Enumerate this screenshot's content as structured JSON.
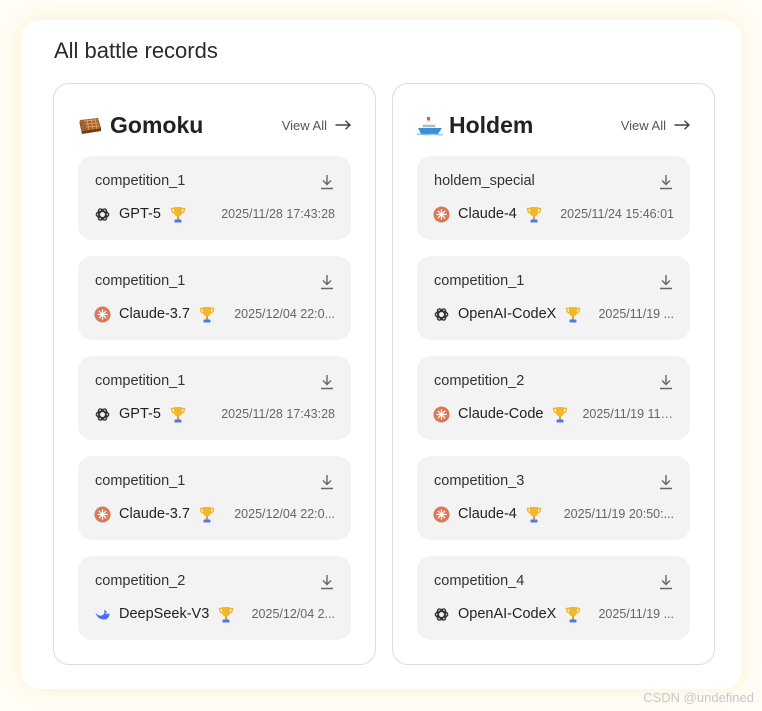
{
  "page_title": "All battle records",
  "watermark": "CSDN @undefined",
  "colors": {
    "claude": "#d97757",
    "deepseek": "#4d6bfe",
    "trophy": "#f2b72a"
  },
  "games": [
    {
      "name": "Gomoku",
      "icon": "gomoku-board-icon",
      "view_all": "View All",
      "records": [
        {
          "name": "competition_1",
          "model": "GPT-5",
          "model_icon": "openai-icon",
          "time": "2025/11/28 17:43:28"
        },
        {
          "name": "competition_1",
          "model": "Claude-3.7",
          "model_icon": "claude-icon",
          "time": "2025/12/04 22:0..."
        },
        {
          "name": "competition_1",
          "model": "GPT-5",
          "model_icon": "openai-icon",
          "time": "2025/11/28 17:43:28"
        },
        {
          "name": "competition_1",
          "model": "Claude-3.7",
          "model_icon": "claude-icon",
          "time": "2025/12/04 22:0..."
        },
        {
          "name": "competition_2",
          "model": "DeepSeek-V3",
          "model_icon": "deepseek-icon",
          "time": "2025/12/04 2..."
        }
      ]
    },
    {
      "name": "Holdem",
      "icon": "ship-icon",
      "view_all": "View All",
      "records": [
        {
          "name": "holdem_special",
          "model": "Claude-4",
          "model_icon": "claude-icon",
          "time": "2025/11/24 15:46:01"
        },
        {
          "name": "competition_1",
          "model": "OpenAI-CodeX",
          "model_icon": "openai-icon",
          "time": "2025/11/19 ..."
        },
        {
          "name": "competition_2",
          "model": "Claude-Code",
          "model_icon": "claude-icon",
          "time": "2025/11/19 11:..."
        },
        {
          "name": "competition_3",
          "model": "Claude-4",
          "model_icon": "claude-icon",
          "time": "2025/11/19 20:50:..."
        },
        {
          "name": "competition_4",
          "model": "OpenAI-CodeX",
          "model_icon": "openai-icon",
          "time": "2025/11/19 ..."
        }
      ]
    }
  ]
}
